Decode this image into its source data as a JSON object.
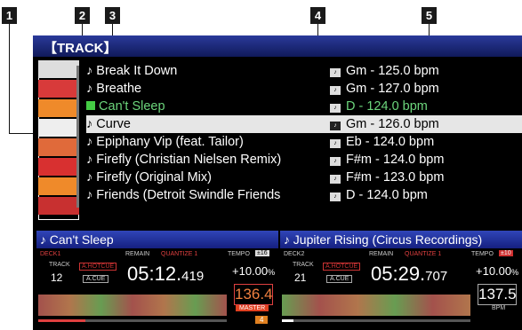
{
  "callouts": [
    "1",
    "2",
    "3",
    "4",
    "5"
  ],
  "browser": {
    "header": "【TRACK】",
    "tracks": [
      {
        "title": "Break It Down",
        "key": "Gm - 125.0 bpm",
        "state": "normal",
        "icon": "note-icon"
      },
      {
        "title": "Breathe",
        "key": "Gm - 127.0 bpm",
        "state": "normal",
        "icon": "note-icon"
      },
      {
        "title": "Can't Sleep",
        "key": "D - 124.0 bpm",
        "state": "playing",
        "icon": "play-indicator-icon"
      },
      {
        "title": "Curve",
        "key": "Gm - 126.0 bpm",
        "state": "selected",
        "icon": "note-icon"
      },
      {
        "title": "Epiphany Vip (feat. Tailor)",
        "key": "Eb - 124.0 bpm",
        "state": "normal",
        "icon": "note-icon"
      },
      {
        "title": "Firefly (Christian Nielsen Remix)",
        "key": "F#m - 124.0 bpm",
        "state": "normal",
        "icon": "note-icon"
      },
      {
        "title": "Firefly (Original Mix)",
        "key": "F#m - 123.0 bpm",
        "state": "normal",
        "icon": "note-icon"
      },
      {
        "title": "Friends (Detroit Swindle Friends",
        "key": "D - 124.0 bpm",
        "state": "normal",
        "icon": "note-icon"
      }
    ]
  },
  "deck1": {
    "title": "Can't Sleep",
    "deck": "DECK1",
    "remain": "REMAIN",
    "quantize": "QUANTIZE 1",
    "tempo_label": "TEMPO",
    "tempo_range": "±16",
    "track_label": "TRACK",
    "track_no": "12",
    "hotcue": "A.HOTCUE",
    "acue": "A.CUE",
    "time": "05:12.",
    "time_ms": "419",
    "pitch": "+10.00",
    "pitch_unit": "%",
    "bpm": "136.4",
    "master": "MASTER",
    "loop": "4"
  },
  "deck2": {
    "title": "Jupiter Rising (Circus Recordings)",
    "deck": "DECK2",
    "remain": "REMAIN",
    "quantize": "QUANTIZE 1",
    "tempo_label": "TEMPO",
    "tempo_range": "±10",
    "track_label": "TRACK",
    "track_no": "21",
    "hotcue": "A.HOTCUE",
    "acue": "A.CUE",
    "time": "05:29.",
    "time_ms": "707",
    "pitch": "+10.00",
    "pitch_unit": "%",
    "bpm": "137.5",
    "bpm_unit": "BPM"
  },
  "colors": {
    "accent": "#2a3a9a",
    "playing": "#6cd67c",
    "selected_bg": "#e6e6e6",
    "warn": "#e04040"
  }
}
